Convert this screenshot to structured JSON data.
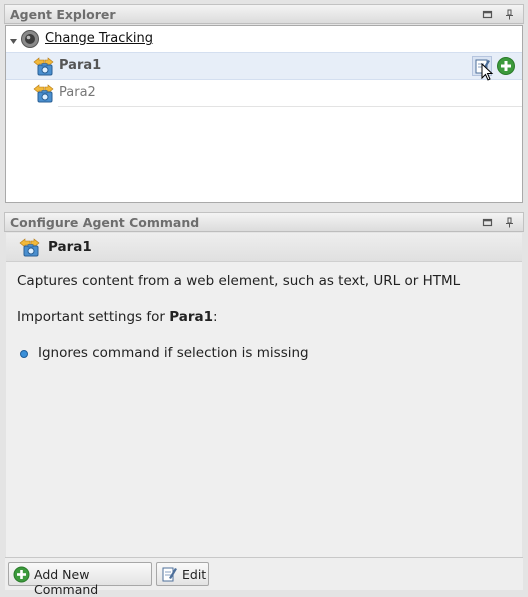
{
  "agent_explorer": {
    "title": "Agent Explorer",
    "root": {
      "label": "Change Tracking",
      "icon": "globe-icon",
      "expanded": true
    },
    "items": [
      {
        "label": "Para1",
        "icon": "capture-command-icon",
        "selected": true
      },
      {
        "label": "Para2",
        "icon": "capture-command-icon",
        "selected": false
      }
    ],
    "row_actions": [
      "edit-icon",
      "add-icon"
    ]
  },
  "configure_command": {
    "title": "Configure Agent Command",
    "command_name": "Para1",
    "description": "Captures content from a web element, such as text, URL or HTML",
    "settings_prefix": "Important settings for ",
    "settings_name": "Para1",
    "settings_suffix": ":",
    "settings": [
      "Ignores command if selection is missing"
    ]
  },
  "toolbar": {
    "add_label": "Add New Command",
    "edit_label": "Edit"
  },
  "colors": {
    "selected_row": "#e7eef8",
    "add_green": "#3c9a3c",
    "bullet_blue": "#3a8fd8"
  }
}
